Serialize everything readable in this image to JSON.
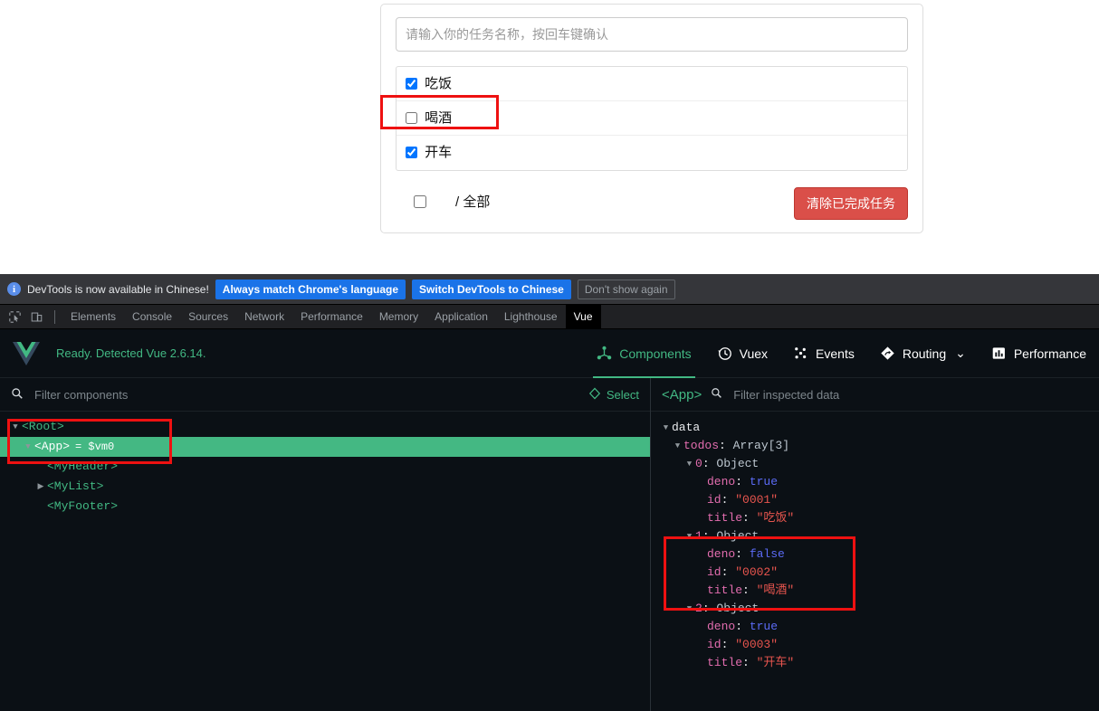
{
  "todo_app": {
    "input": {
      "value": "",
      "placeholder": "请输入你的任务名称，按回车键确认"
    },
    "items": [
      {
        "label": "吃饭",
        "checked": true
      },
      {
        "label": "喝酒",
        "checked": false
      },
      {
        "label": "开车",
        "checked": true
      }
    ],
    "footer": {
      "select_all_checked": false,
      "summary": "/ 全部",
      "clear_button": "清除已完成任务"
    },
    "colors": {
      "danger": "#da4f49",
      "danger_border": "#bd362f",
      "highlight": "#ee1111"
    }
  },
  "devtools": {
    "notice": {
      "icon": "info-icon",
      "message": "DevTools is now available in Chinese!",
      "primary_button": "Always match Chrome's language",
      "secondary_button": "Switch DevTools to Chinese",
      "dismiss_button": "Don't show again"
    },
    "toolbar_icons": [
      "inspect-element-icon",
      "device-toolbar-icon"
    ],
    "tabs": [
      {
        "label": "Elements",
        "active": false
      },
      {
        "label": "Console",
        "active": false
      },
      {
        "label": "Sources",
        "active": false
      },
      {
        "label": "Network",
        "active": false
      },
      {
        "label": "Performance",
        "active": false
      },
      {
        "label": "Memory",
        "active": false
      },
      {
        "label": "Application",
        "active": false
      },
      {
        "label": "Lighthouse",
        "active": false
      },
      {
        "label": "Vue",
        "active": true
      }
    ]
  },
  "vue_panel": {
    "logo": "vue-logo-icon",
    "status": "Ready. Detected Vue 2.6.14.",
    "nav": [
      {
        "label": "Components",
        "icon": "components-icon",
        "active": true,
        "caret": false
      },
      {
        "label": "Vuex",
        "icon": "vuex-clock-icon",
        "active": false,
        "caret": false
      },
      {
        "label": "Events",
        "icon": "events-icon",
        "active": false,
        "caret": false
      },
      {
        "label": "Routing",
        "icon": "routing-icon",
        "active": false,
        "caret": true
      },
      {
        "label": "Performance",
        "icon": "performance-icon",
        "active": false,
        "caret": false
      }
    ],
    "components_toolbar": {
      "search_icon": "search-icon",
      "filter_placeholder": "Filter components",
      "filter_value": "",
      "select_icon": "target-select-icon",
      "select_label": "Select"
    },
    "tree": [
      {
        "name": "<Root>",
        "depth": 0,
        "caret": "down",
        "selected": false,
        "suffix": ""
      },
      {
        "name": "<App>",
        "depth": 1,
        "caret": "down",
        "selected": true,
        "suffix": "= $vm0"
      },
      {
        "name": "<MyHeader>",
        "depth": 2,
        "caret": "none",
        "selected": false,
        "suffix": ""
      },
      {
        "name": "<MyList>",
        "depth": 2,
        "caret": "right",
        "selected": false,
        "suffix": ""
      },
      {
        "name": "<MyFooter>",
        "depth": 2,
        "caret": "none",
        "selected": false,
        "suffix": ""
      }
    ],
    "inspector_toolbar": {
      "component": "<App>",
      "search_icon": "search-icon",
      "filter_placeholder": "Filter inspected data",
      "filter_value": ""
    },
    "inspector": {
      "root_label": "data",
      "todos_key": "todos",
      "todos_type": "Array[3]",
      "objects": [
        {
          "index": "0",
          "type": "Object",
          "props": [
            {
              "key": "deno",
              "value": "true",
              "kind": "bool"
            },
            {
              "key": "id",
              "value": "\"0001\"",
              "kind": "string"
            },
            {
              "key": "title",
              "value": "\"吃饭\"",
              "kind": "string"
            }
          ]
        },
        {
          "index": "1",
          "type": "Object",
          "props": [
            {
              "key": "deno",
              "value": "false",
              "kind": "bool"
            },
            {
              "key": "id",
              "value": "\"0002\"",
              "kind": "string"
            },
            {
              "key": "title",
              "value": "\"喝酒\"",
              "kind": "string"
            }
          ]
        },
        {
          "index": "2",
          "type": "Object",
          "props": [
            {
              "key": "deno",
              "value": "true",
              "kind": "bool"
            },
            {
              "key": "id",
              "value": "\"0003\"",
              "kind": "string"
            },
            {
              "key": "title",
              "value": "\"开车\"",
              "kind": "string"
            }
          ]
        }
      ]
    }
  }
}
